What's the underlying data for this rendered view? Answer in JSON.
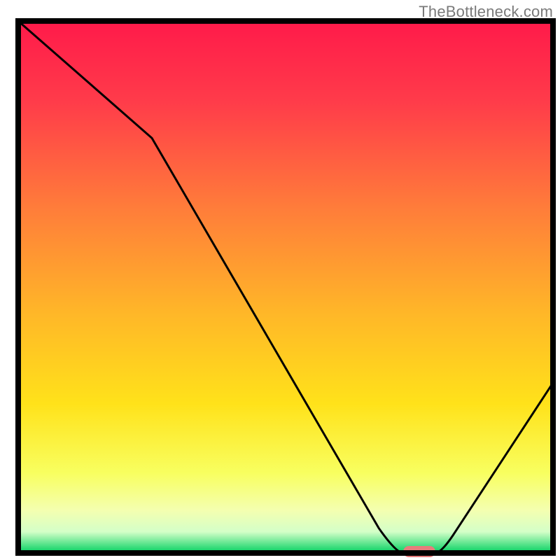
{
  "watermark": "TheBottleneck.com",
  "chart_data": {
    "type": "line",
    "title": "",
    "xlabel": "",
    "ylabel": "",
    "xlim": [
      0,
      100
    ],
    "ylim": [
      0,
      100
    ],
    "x": [
      0,
      25,
      72,
      78,
      100
    ],
    "values": [
      100,
      78,
      0,
      0,
      32
    ],
    "marker": {
      "x_start": 72,
      "x_end": 78,
      "y": 0,
      "color": "#e77c7c"
    },
    "gradient_stops": [
      {
        "offset": 0.0,
        "color": "#ff1a4a"
      },
      {
        "offset": 0.15,
        "color": "#ff3b4a"
      },
      {
        "offset": 0.35,
        "color": "#ff7c3a"
      },
      {
        "offset": 0.55,
        "color": "#ffb728"
      },
      {
        "offset": 0.72,
        "color": "#ffe21a"
      },
      {
        "offset": 0.85,
        "color": "#f8ff60"
      },
      {
        "offset": 0.92,
        "color": "#f4ffb0"
      },
      {
        "offset": 0.96,
        "color": "#d4ffc8"
      },
      {
        "offset": 1.0,
        "color": "#00d060"
      }
    ],
    "frame_color": "#000000",
    "line_color": "#000000",
    "line_width": 3
  }
}
